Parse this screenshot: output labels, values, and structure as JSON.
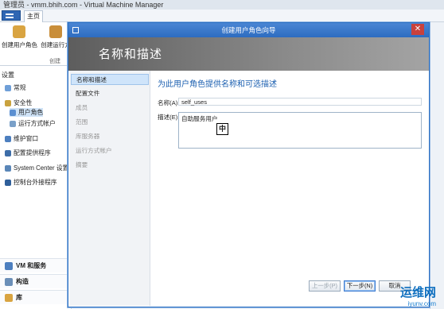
{
  "window": {
    "title": "管理员 - vmm.bhih.com - Virtual Machine Manager"
  },
  "ribbon": {
    "tab_main": "主页",
    "buttons": [
      {
        "label": "创建用户角色",
        "icon": "user-role-icon"
      },
      {
        "label": "创建运行方",
        "icon": "run-as-icon"
      }
    ],
    "group_label": "创建"
  },
  "nav": {
    "section": "设置",
    "items": [
      {
        "label": "常规",
        "icon": "settings-icon"
      },
      {
        "label": "安全性",
        "icon": "lock-icon"
      },
      {
        "label": "用户角色",
        "icon": "users-icon"
      },
      {
        "label": "运行方式帐户",
        "icon": "account-icon"
      },
      {
        "label": "维护窗口",
        "icon": "window-icon"
      },
      {
        "label": "配置提供程序",
        "icon": "provider-icon"
      },
      {
        "label": "System Center 设置",
        "icon": "system-center-icon"
      },
      {
        "label": "控制台外接程序",
        "icon": "addin-icon"
      }
    ],
    "workspaces": [
      {
        "label": "VM 和服务",
        "icon": "vm-icon"
      },
      {
        "label": "构造",
        "icon": "fabric-icon"
      },
      {
        "label": "库",
        "icon": "library-icon"
      }
    ]
  },
  "wizard": {
    "title": "创建用户角色向导",
    "header": "名称和描述",
    "steps": [
      "名称和描述",
      "配置文件",
      "成员",
      "范围",
      "库服务器",
      "运行方式帐户",
      "摘要"
    ],
    "instruction": "为此用户角色提供名称和可选描述",
    "name_label": "名称(A):",
    "name_value": "self_uses",
    "desc_label": "描述(E):",
    "desc_value": "自助服务用户",
    "ime_indicator": "中",
    "prev_button": "上一步(P)",
    "next_button": "下一步(N)",
    "cancel_button": "取消"
  },
  "watermark": {
    "line1": "运维网",
    "line2": "iyunv.com"
  },
  "colors": {
    "accent": "#2d6cc0",
    "header_bg": "#7a7a7a",
    "instruction": "#1b5fb0"
  }
}
